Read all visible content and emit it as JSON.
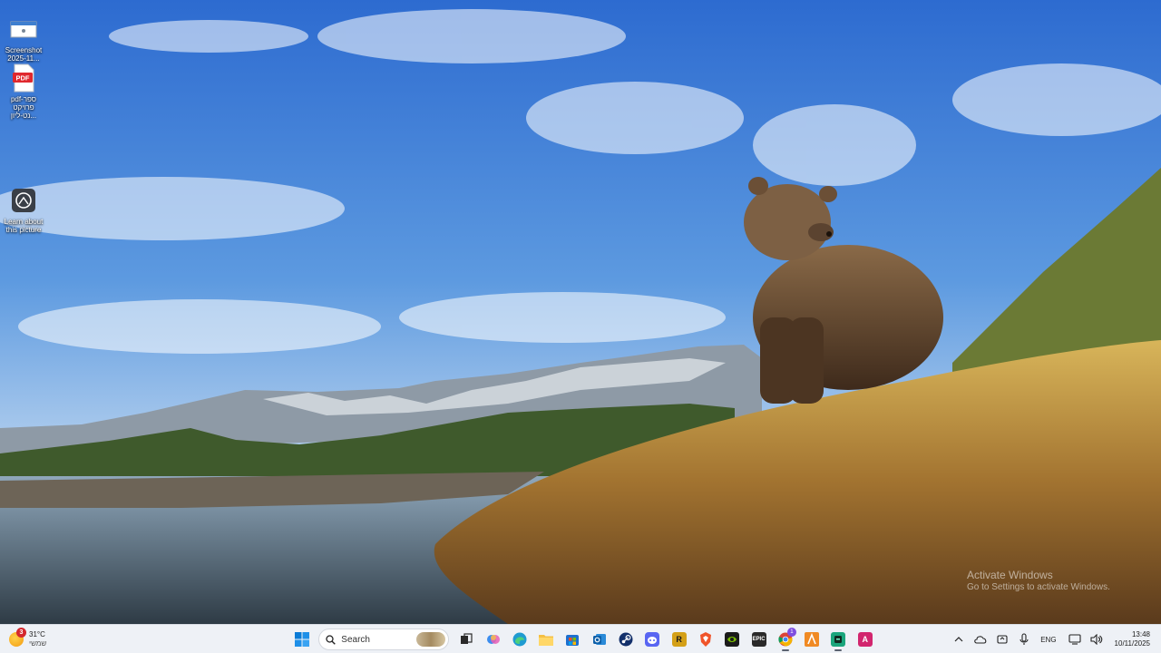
{
  "desktop": {
    "icons": [
      {
        "label": "Screenshot 2025-11...",
        "icon": "screenshot-file-icon"
      },
      {
        "label": "pdf-ספר פרויקט נט-ליון...",
        "icon": "pdf-file-icon",
        "badge": "PDF"
      },
      {
        "label": "Learn about this picture",
        "icon": "camera-circle-icon"
      }
    ],
    "watermark": {
      "title": "Activate Windows",
      "subtitle": "Go to Settings to activate Windows."
    }
  },
  "taskbar": {
    "weather": {
      "temperature": "31°C",
      "condition": "שמשי",
      "badge_count": "3"
    },
    "search": {
      "placeholder": "Search"
    },
    "pinned_apps": [
      {
        "name": "windows-start-icon"
      },
      {
        "name": "search"
      },
      {
        "name": "task-view-icon"
      },
      {
        "name": "copilot-icon"
      },
      {
        "name": "edge-icon"
      },
      {
        "name": "file-explorer-icon"
      },
      {
        "name": "microsoft-store-icon"
      },
      {
        "name": "outlook-icon"
      },
      {
        "name": "steam-icon"
      },
      {
        "name": "discord-icon"
      },
      {
        "name": "gold-app-icon"
      },
      {
        "name": "brave-icon"
      },
      {
        "name": "nvidia-icon"
      },
      {
        "name": "epic-games-icon"
      },
      {
        "name": "chrome-icon"
      },
      {
        "name": "orange-app-icon"
      },
      {
        "name": "terminal-app-icon"
      },
      {
        "name": "pink-app-icon"
      }
    ],
    "chrome_badge": "1",
    "tray": {
      "language": "ENG",
      "time": "13:48",
      "date": "10/11/2025"
    }
  },
  "colors": {
    "taskbar_bg": "#eef1f6",
    "sky_top": "#2f6fd0",
    "sky_bottom": "#cfe2f5",
    "accent_windows": "#0a7bd6"
  }
}
